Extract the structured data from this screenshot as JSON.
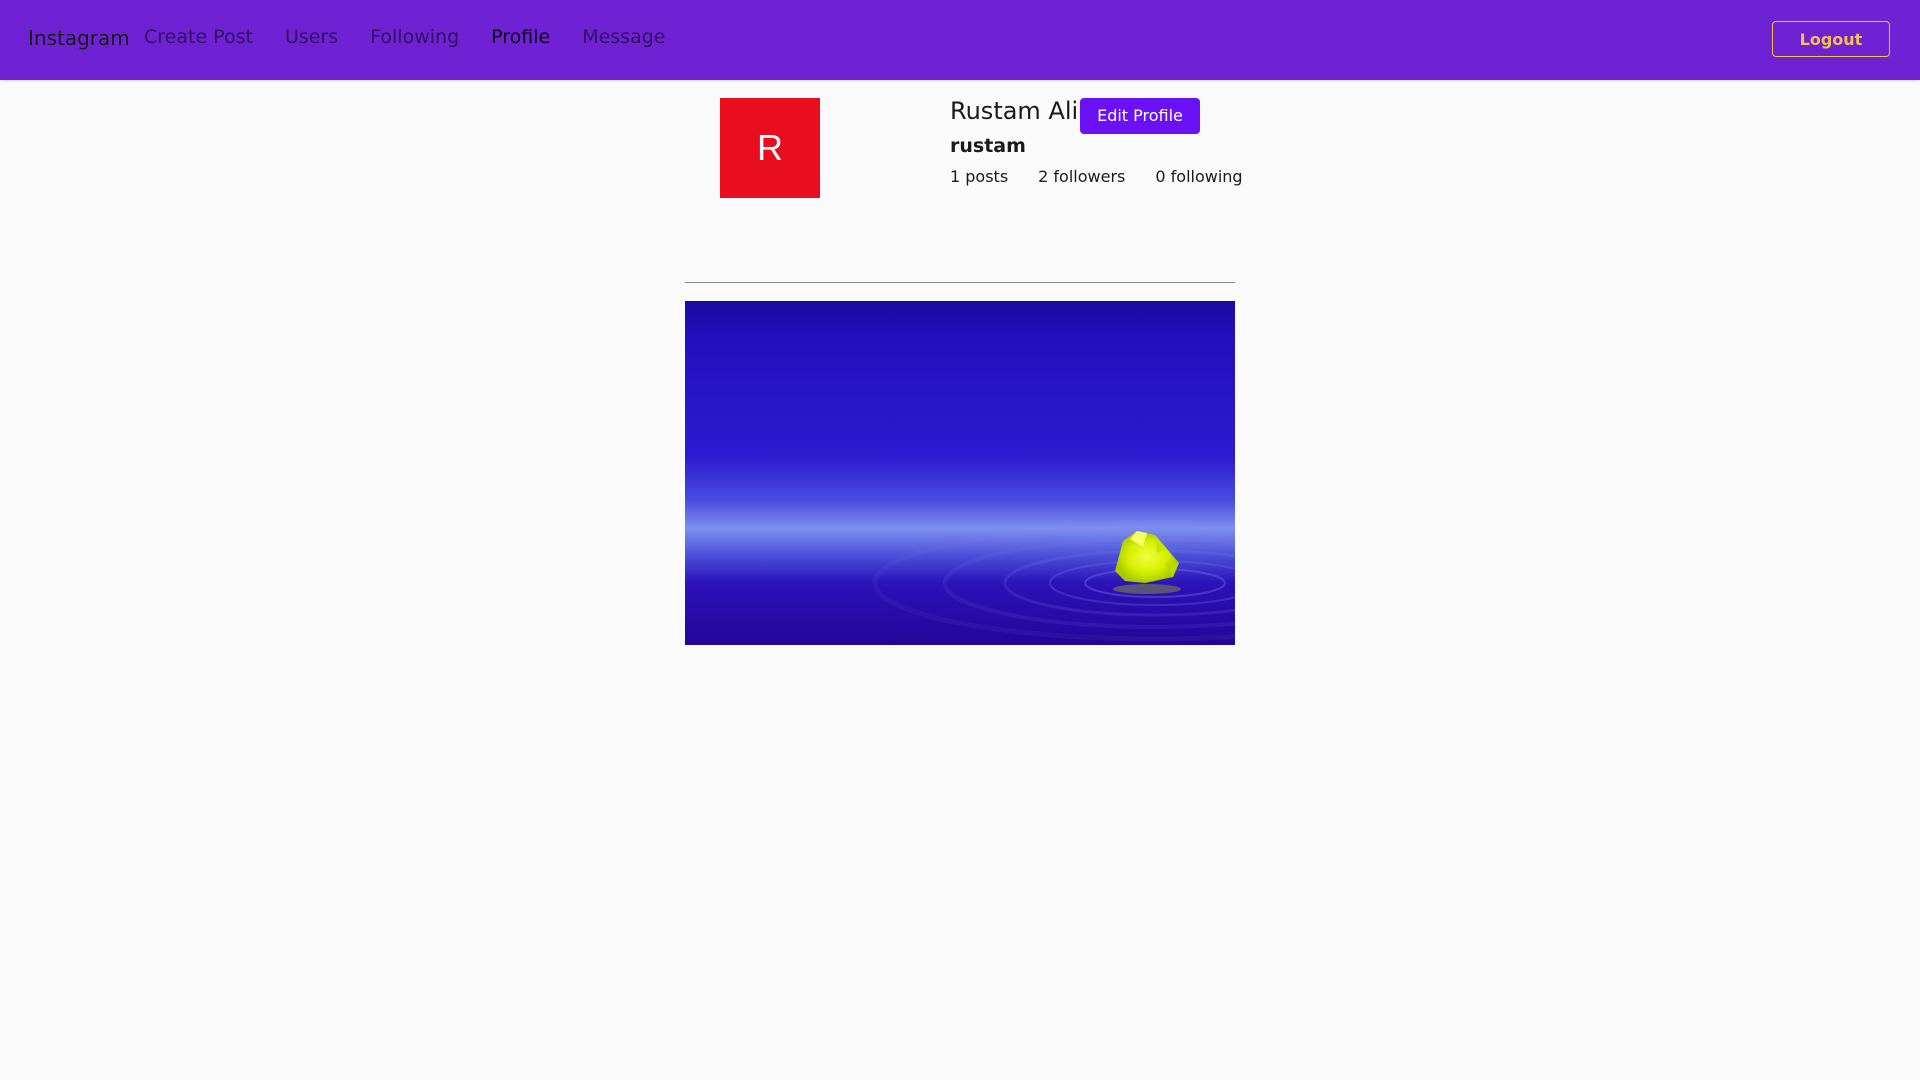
{
  "navbar": {
    "brand": "Instagram",
    "links": [
      {
        "label": "Create Post",
        "active": false
      },
      {
        "label": "Users",
        "active": false
      },
      {
        "label": "Following",
        "active": false
      },
      {
        "label": "Profile",
        "active": true
      },
      {
        "label": "Message",
        "active": false
      }
    ],
    "logout_label": "Logout"
  },
  "profile": {
    "avatar_letter": "R",
    "full_name": "Rustam Ali",
    "edit_label": "Edit Profile",
    "username": "rustam",
    "stats": {
      "posts": "1 posts",
      "followers": "2 followers",
      "following": "0 following"
    }
  },
  "colors": {
    "navbar_bg": "#6f22d3",
    "logout_accent": "#f3c24a",
    "edit_button": "#6a12f5",
    "avatar_bg": "#e80d1f",
    "page_bg": "#fafafa"
  }
}
